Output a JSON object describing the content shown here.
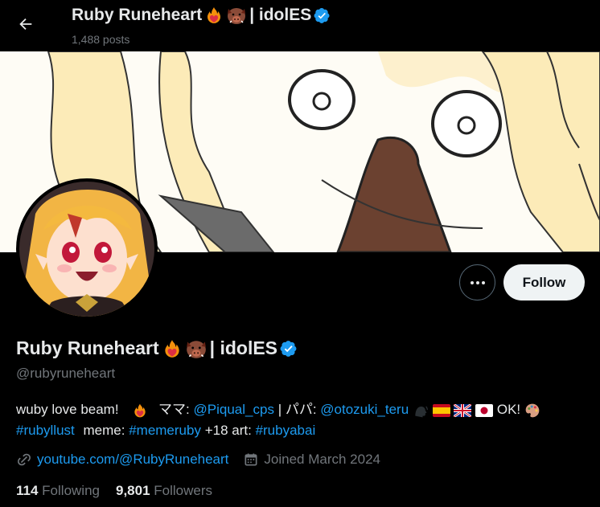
{
  "header": {
    "name_prefix": "Ruby Runeheart",
    "name_suffix": "| idolES",
    "posts": "1,488 posts"
  },
  "profile": {
    "name_prefix": "Ruby Runeheart",
    "name_suffix": "| idolES",
    "handle": "@rubyruneheart"
  },
  "actions": {
    "follow_label": "Follow"
  },
  "bio": {
    "part1": "wuby love beam!",
    "part2": "ママ:",
    "mama_link": "@Piqual_cps",
    "part3": "| パパ:",
    "papa_link": "@otozuki_teru",
    "part4": "OK!",
    "tag1": "#rubyllust",
    "part5": "meme:",
    "tag2": "#memeruby",
    "part6": "+18 art:",
    "tag3": "#rubyabai"
  },
  "meta": {
    "website": "youtube.com/@RubyRuneheart",
    "joined": "Joined March 2024"
  },
  "stats": {
    "following_count": "114",
    "following_label": "Following",
    "followers_count": "9,801",
    "followers_label": "Followers"
  },
  "colors": {
    "accent": "#1d9bf0",
    "background": "#000000",
    "muted": "#71767b"
  }
}
